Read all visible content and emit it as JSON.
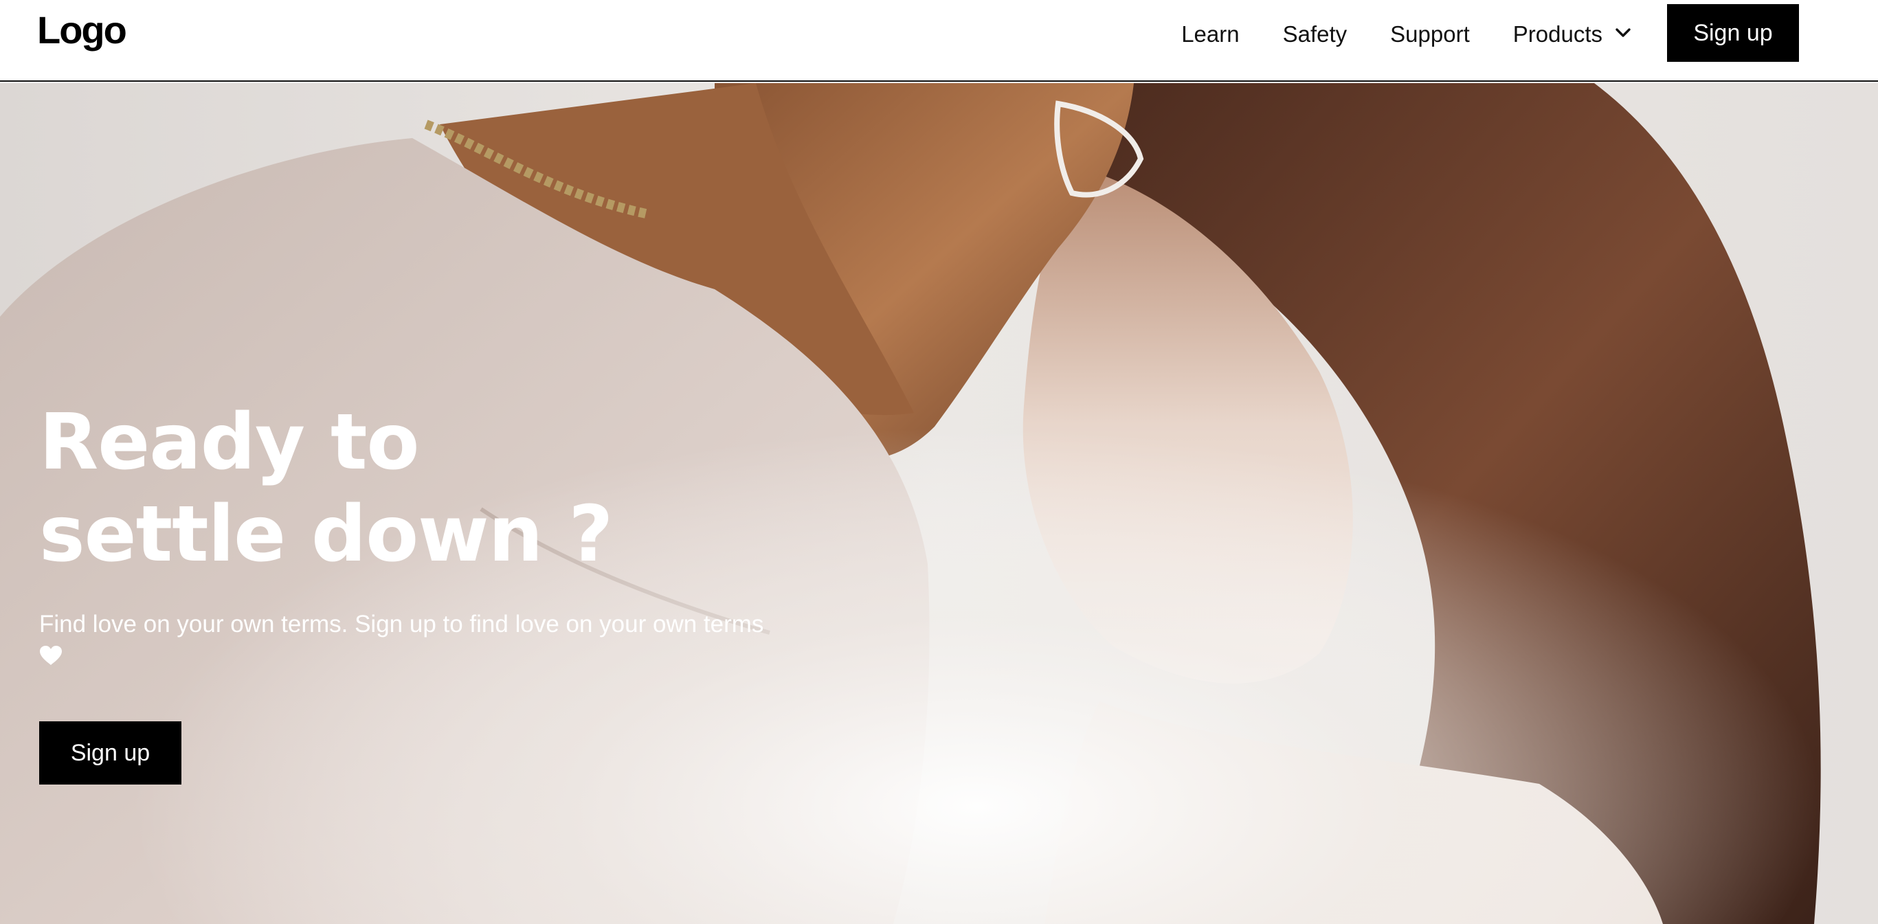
{
  "brand": {
    "logo": "Logo"
  },
  "nav": {
    "links": [
      {
        "label": "Learn"
      },
      {
        "label": "Safety"
      },
      {
        "label": "Support"
      },
      {
        "label": "Products",
        "icon": "chevron-down-icon"
      }
    ],
    "signup_label": "Sign up"
  },
  "hero": {
    "title_line1": "Ready to",
    "title_line2": "settle down ?",
    "subtitle": "Find love on your own terms. Sign up to find love on your own terms",
    "subtitle_icon": "heart-icon",
    "cta_label": "Sign up",
    "image": "photo of a couple touching foreheads"
  },
  "colors": {
    "primary_button": "#000000",
    "button_text": "#ffffff",
    "hero_text": "#ffffff",
    "nav_text": "#111111"
  }
}
